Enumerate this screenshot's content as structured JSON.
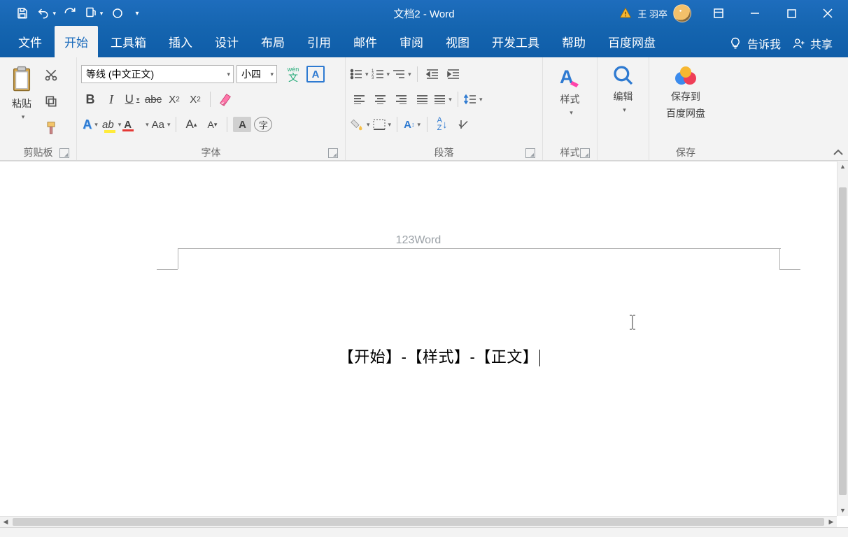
{
  "title": "文档2  -  Word",
  "user_name": "王 羽卒",
  "qat": {
    "save": "保存",
    "undo": "撤销",
    "redo": "重做"
  },
  "tabs": [
    "文件",
    "开始",
    "工具箱",
    "插入",
    "设计",
    "布局",
    "引用",
    "邮件",
    "审阅",
    "视图",
    "开发工具",
    "帮助",
    "百度网盘"
  ],
  "active_tab": "开始",
  "tellme": "告诉我",
  "share": "共享",
  "clipboard": {
    "paste": "粘贴",
    "group": "剪贴板"
  },
  "font": {
    "group": "字体",
    "family": "等线 (中文正文)",
    "size": "小四",
    "pinyin": "wén",
    "pinyin_char": "文"
  },
  "paragraph": {
    "group": "段落"
  },
  "styles": {
    "btn": "样式",
    "group": "样式"
  },
  "editing": {
    "btn": "编辑"
  },
  "baidu": {
    "btn1": "保存到",
    "btn2": "百度网盘",
    "group": "保存"
  },
  "doc": {
    "header_text": "123Word",
    "body_text": "【开始】-【样式】-【正文】"
  }
}
